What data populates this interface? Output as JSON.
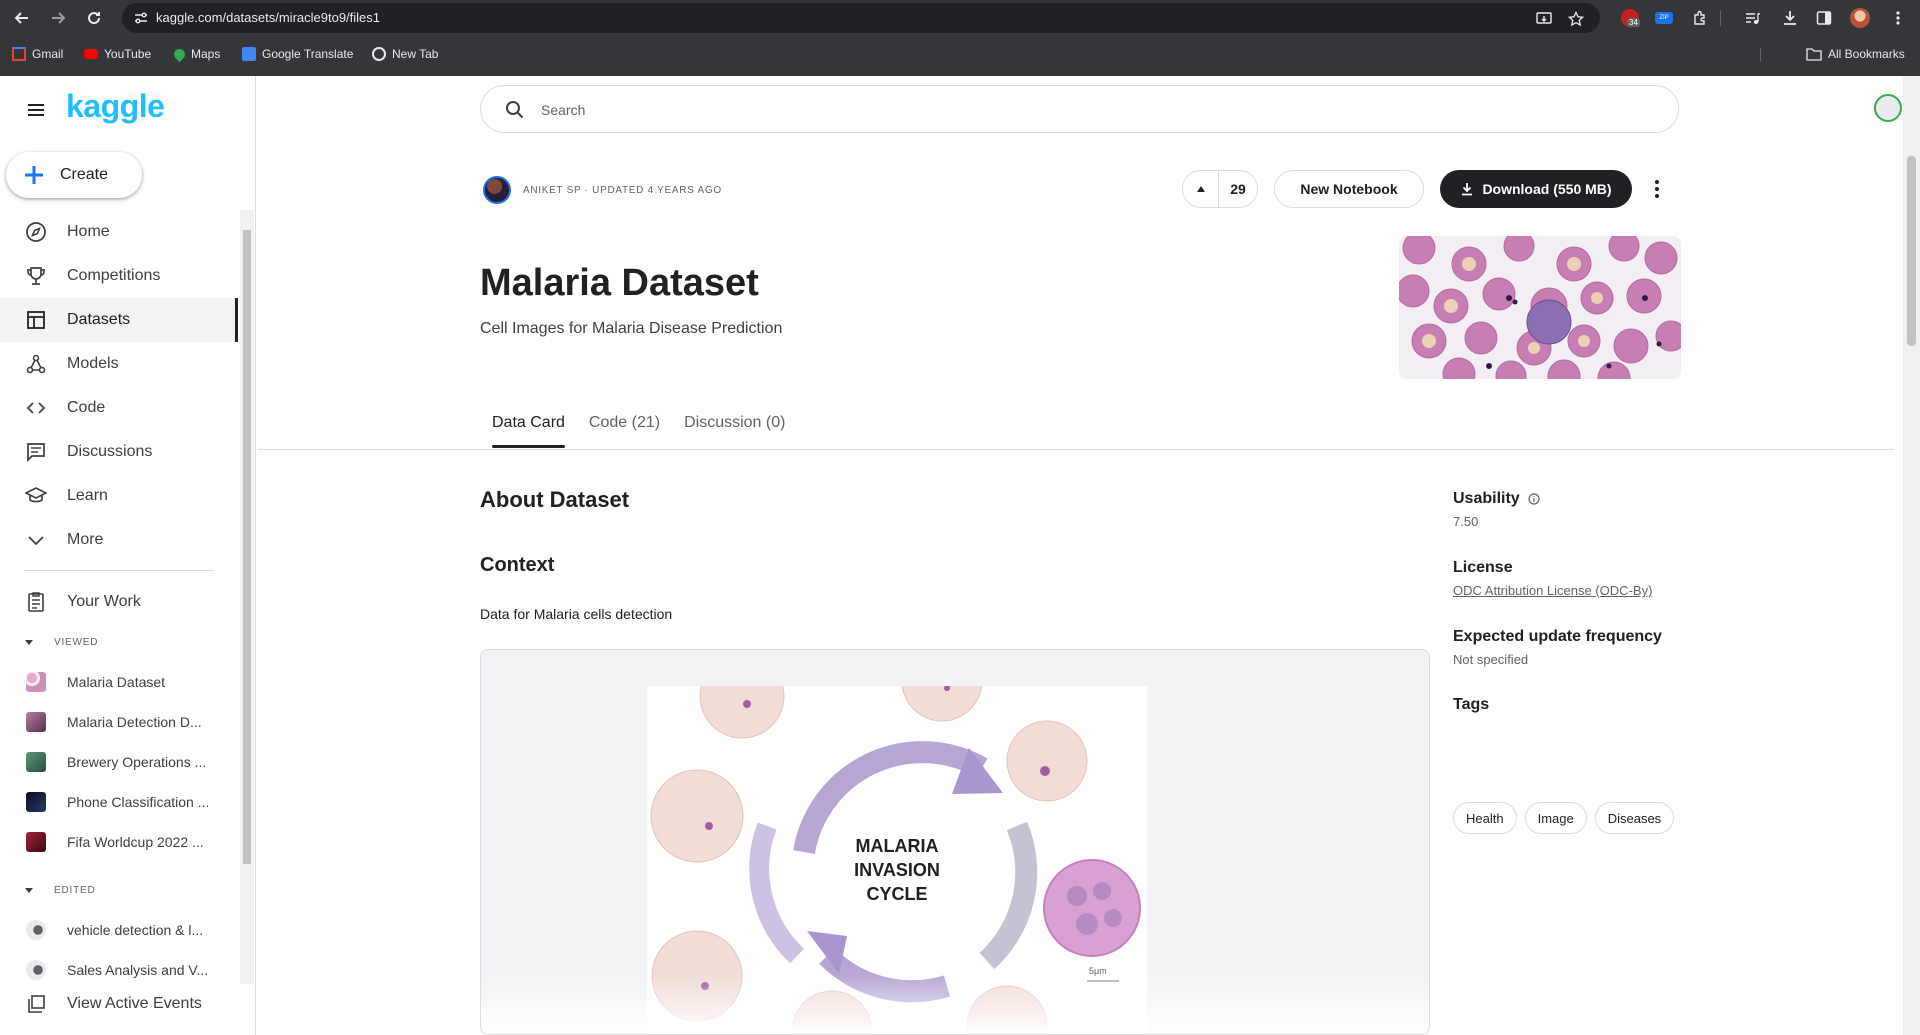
{
  "browser": {
    "url": "kaggle.com/datasets/miracle9to9/files1",
    "bookmarks": [
      {
        "label": "Gmail",
        "icon": "gmail-icon",
        "color": "#ea4335"
      },
      {
        "label": "YouTube",
        "icon": "youtube-icon",
        "color": "#ff0000"
      },
      {
        "label": "Maps",
        "icon": "maps-icon",
        "color": "#34a853"
      },
      {
        "label": "Google Translate",
        "icon": "translate-icon",
        "color": "#4285f4"
      },
      {
        "label": "New Tab",
        "icon": "globe-icon",
        "color": "#e8eaed"
      }
    ],
    "all_bookmarks": "All Bookmarks",
    "ext_badge": "34"
  },
  "sidebar": {
    "logo": "kaggle",
    "create_label": "Create",
    "nav": [
      {
        "label": "Home",
        "icon": "compass-icon",
        "active": false
      },
      {
        "label": "Competitions",
        "icon": "trophy-icon",
        "active": false
      },
      {
        "label": "Datasets",
        "icon": "table-icon",
        "active": true
      },
      {
        "label": "Models",
        "icon": "models-icon",
        "active": false
      },
      {
        "label": "Code",
        "icon": "code-icon",
        "active": false
      },
      {
        "label": "Discussions",
        "icon": "discussion-icon",
        "active": false
      },
      {
        "label": "Learn",
        "icon": "school-icon",
        "active": false
      },
      {
        "label": "More",
        "icon": "chevron-down-icon",
        "active": false
      }
    ],
    "your_work": "Your Work",
    "viewed_header": "VIEWED",
    "viewed": [
      {
        "label": "Malaria Dataset",
        "color": "#c993b8"
      },
      {
        "label": "Malaria Detection D...",
        "color": "#8c5a7a"
      },
      {
        "label": "Brewery Operations ...",
        "color": "#3b6b5a"
      },
      {
        "label": "Phone Classification ...",
        "color": "#1a1a2e"
      },
      {
        "label": "Fifa Worldcup 2022 ...",
        "color": "#7a1d2e"
      }
    ],
    "edited_header": "EDITED",
    "edited": [
      {
        "label": "vehicle detection & l...",
        "color": "#9aa0a6"
      },
      {
        "label": "Sales Analysis and V...",
        "color": "#9aa0a6"
      }
    ],
    "view_events": "View Active Events"
  },
  "search": {
    "placeholder": "Search"
  },
  "dataset": {
    "owner_line": "ANIKET SP · UPDATED 4 YEARS AGO",
    "votes": "29",
    "new_notebook": "New Notebook",
    "download": "Download (550 MB)",
    "title": "Malaria Dataset",
    "subtitle": "Cell Images for Malaria Disease Prediction",
    "tabs": [
      {
        "label": "Data Card",
        "active": true
      },
      {
        "label": "Code (21)",
        "active": false
      },
      {
        "label": "Discussion (0)",
        "active": false
      }
    ]
  },
  "content": {
    "about_heading": "About Dataset",
    "context_heading": "Context",
    "context_text": "Data for Malaria cells detection",
    "figure_text_1": "MALARIA",
    "figure_text_2": "INVASION",
    "figure_text_3": "CYCLE",
    "figure_scale": "5μm"
  },
  "meta": {
    "usability_label": "Usability",
    "usability_value": "7.50",
    "license_label": "License",
    "license_value": "ODC Attribution License (ODC-By)",
    "frequency_label": "Expected update frequency",
    "frequency_value": "Not specified",
    "tags_label": "Tags",
    "tags": [
      "Health",
      "Image",
      "Diseases"
    ]
  }
}
